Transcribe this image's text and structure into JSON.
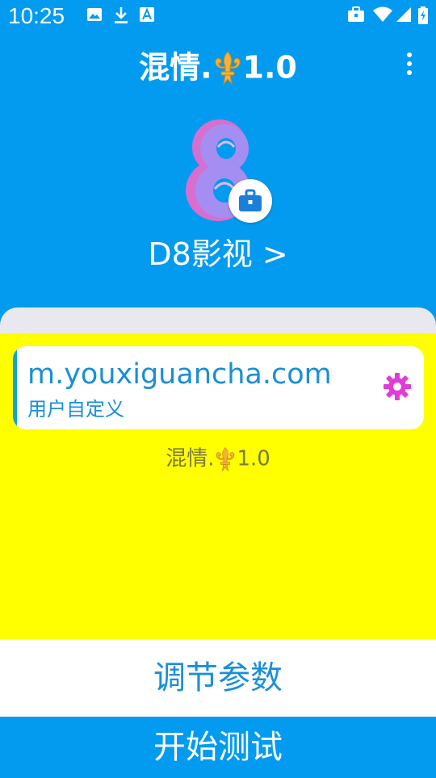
{
  "status_bar": {
    "time": "10:25",
    "left_icons": [
      "image-icon",
      "download-icon",
      "font-icon"
    ],
    "right_icons": [
      "briefcase-icon",
      "wifi-icon",
      "signal-icon",
      "battery-icon"
    ]
  },
  "app_bar": {
    "title_prefix": "混情.",
    "title_suffix": "1.0",
    "title_emblem": "fleur-de-lis-icon",
    "menu_icon": "more-vert-icon"
  },
  "site": {
    "logo": "d8-logo",
    "badge_icon": "briefcase-icon",
    "name": "D8影视 >"
  },
  "entry": {
    "url": "m.youxiguancha.com",
    "subtitle": "用户自定义",
    "settings_icon": "gear-icon"
  },
  "footer_caption": {
    "prefix": "混情.",
    "suffix": "1.0"
  },
  "buttons": {
    "adjust_label": "调节参数",
    "start_label": "开始测试"
  },
  "colors": {
    "primary": "#039bf0",
    "highlight": "#ffff00",
    "link_text": "#1a8fd8",
    "gear": "#e23cd6",
    "emblem": "#f4b23a"
  }
}
